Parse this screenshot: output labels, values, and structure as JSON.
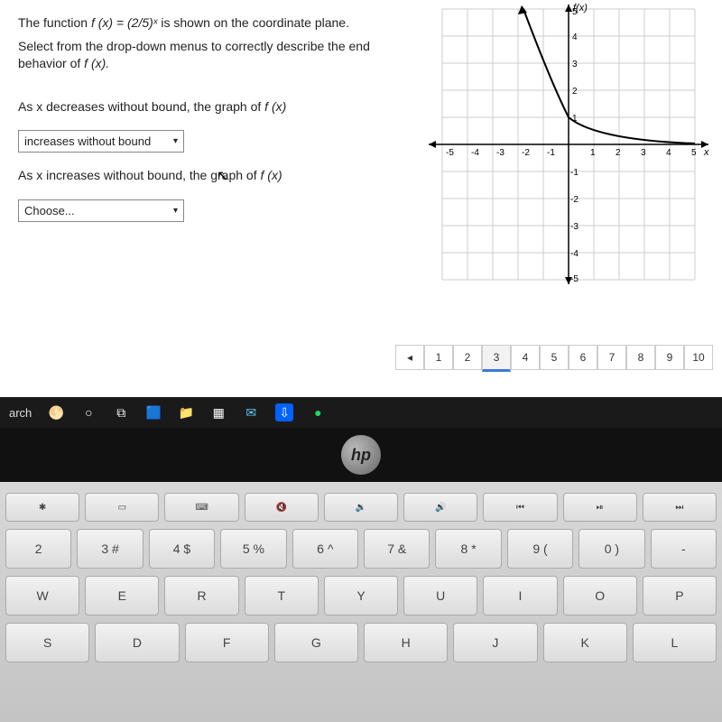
{
  "question": {
    "intro_a": "The function ",
    "intro_b": " is shown on the coordinate plane.",
    "func": "f (x) = (2/5)ˣ",
    "instruction_a": "Select from the drop-down menus to correctly describe the end",
    "instruction_b": "behavior of ",
    "fx": "f (x).",
    "prompt1_a": "As x decreases without bound, the graph of ",
    "prompt1_b": "f (x)",
    "dropdown1": "increases without bound",
    "prompt2_a": "As x increases without bound, the graph of ",
    "prompt2_b": "f (x)",
    "dropdown2": "Choose..."
  },
  "chart_data": {
    "type": "line",
    "title": "",
    "xlabel": "x",
    "ylabel": "f(x)",
    "xlim": [
      -5,
      5
    ],
    "ylim": [
      -5,
      5
    ],
    "x_ticks": [
      -5,
      -4,
      -3,
      -2,
      -1,
      1,
      2,
      3,
      4,
      5
    ],
    "y_ticks": [
      -5,
      -4,
      -3,
      -2,
      -1,
      1,
      2,
      3,
      4,
      5
    ],
    "series": [
      {
        "name": "f(x)=(2/5)^x",
        "points": [
          [
            -2,
            6.25
          ],
          [
            -1.5,
            3.95
          ],
          [
            -1,
            2.5
          ],
          [
            -0.5,
            1.58
          ],
          [
            0,
            1
          ],
          [
            1,
            0.4
          ],
          [
            2,
            0.16
          ],
          [
            3,
            0.064
          ],
          [
            4,
            0.0256
          ],
          [
            5,
            0.01
          ]
        ]
      }
    ]
  },
  "pagination": {
    "prev": "◂",
    "pages": [
      "1",
      "2",
      "3",
      "4",
      "5",
      "6",
      "7",
      "8",
      "9",
      "10"
    ],
    "active": 3
  },
  "taskbar": {
    "search": "arch",
    "icons": [
      "🌕",
      "○",
      "⧉",
      "🟦",
      "📁",
      "▦",
      "✉",
      "⇩",
      "●"
    ]
  },
  "laptop": {
    "brand": "hp"
  },
  "keyboard": {
    "fn_row": [
      "✱",
      "▭",
      "⌨",
      "🔇",
      "🔉",
      "🔊",
      "⏮",
      "⏯",
      "⏭"
    ],
    "num_row": [
      "2",
      "3 #",
      "4 $",
      "5 %",
      "6 ^",
      "7 &",
      "8 *",
      "9 (",
      "0 )",
      "-"
    ],
    "row1": [
      "W",
      "E",
      "R",
      "T",
      "Y",
      "U",
      "I",
      "O",
      "P"
    ],
    "row2": [
      "S",
      "D",
      "F",
      "G",
      "H",
      "J",
      "K",
      "L"
    ]
  }
}
